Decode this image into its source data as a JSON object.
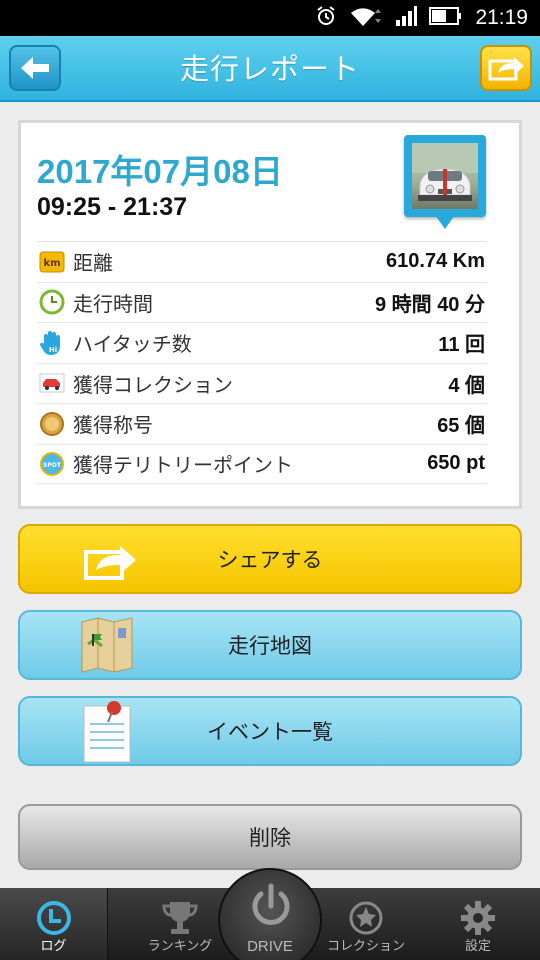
{
  "status_bar": {
    "time": "21:19"
  },
  "header": {
    "title": "走行レポート"
  },
  "report": {
    "date": "2017年07月08日",
    "time_range": "09:25 - 21:37",
    "stats": [
      {
        "icon": "km-icon",
        "label": "距離",
        "value": "610.74 Km"
      },
      {
        "icon": "clock-icon",
        "label": "走行時間",
        "value": "9 時間 40 分"
      },
      {
        "icon": "hi-touch-icon",
        "label": "ハイタッチ数",
        "value": "11 回"
      },
      {
        "icon": "car-icon",
        "label": "獲得コレクション",
        "value": "4 個"
      },
      {
        "icon": "medal-icon",
        "label": "獲得称号",
        "value": "65 個"
      },
      {
        "icon": "spot-icon",
        "label": "獲得テリトリーポイント",
        "value": "650 pt"
      }
    ],
    "icon_texts": {
      "km": "km",
      "spot": "SPOT",
      "hi": "Hi"
    }
  },
  "buttons": {
    "share": "シェアする",
    "map": "走行地図",
    "events": "イベント一覧",
    "delete": "削除"
  },
  "bottom_nav": {
    "log": "ログ",
    "ranking": "ランキング",
    "drive": "DRIVE",
    "collection": "コレクション",
    "settings": "設定"
  },
  "colors": {
    "accent": "#2fa8cf",
    "share_yellow": "#f5c400",
    "light_blue": "#6fcbe8"
  }
}
